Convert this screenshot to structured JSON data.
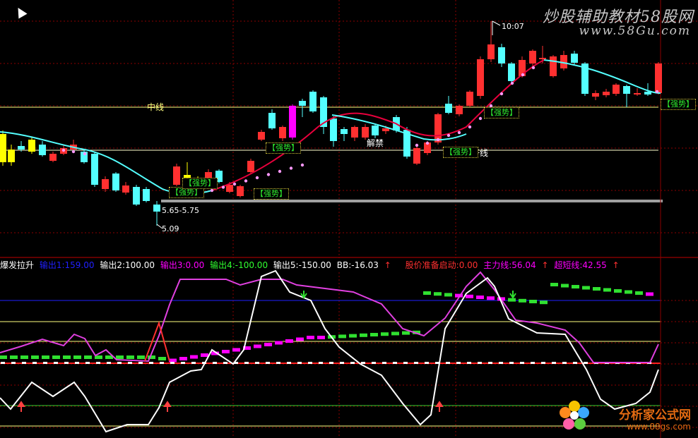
{
  "app": {
    "title": "炒股辅助教材58股网",
    "watermark_url": "www.58Gu.com"
  },
  "footer": {
    "brand": "分析家公式网",
    "url": "www.88gs.com"
  },
  "main": {
    "labels": {
      "mid_line": "中线",
      "jiejin": "解禁",
      "gan_line": "干线",
      "high": "10:07",
      "range": "5.65-5.75",
      "low": "5.09"
    },
    "tags": [
      "【强势】",
      "【强势】",
      "【强势】",
      "【强势】",
      "【强势】",
      "【强势】",
      "【强势】"
    ],
    "colors": {
      "up": "#ff3030",
      "down": "#54ffff",
      "yellow_candle": "#ffff00",
      "magenta_candle": "#ff00ff",
      "ma_cyan": "#54ffff",
      "ma_red": "#e8003c",
      "grid_red": "#8b0000"
    }
  },
  "indicator": {
    "name": "爆发拉升",
    "items": [
      {
        "label": "输出1:159.00",
        "color": "#2020ff"
      },
      {
        "label": "输出2:100.00",
        "color": "#ffffff"
      },
      {
        "label": "输出3:0.00",
        "color": "#ff00ff"
      },
      {
        "label": "输出4:-100.00",
        "color": "#30ff30"
      },
      {
        "label": "输出5:-150.00",
        "color": "#ffffff"
      },
      {
        "label": "BB:-16.03",
        "color": "#ffffff"
      },
      {
        "label": "股价准备启动:0.00",
        "color": "#ff3030"
      },
      {
        "label": "主力线:56.04",
        "color": "#ff00ff"
      },
      {
        "label": "超短线:42.55",
        "color": "#ff00ff"
      }
    ]
  }
}
